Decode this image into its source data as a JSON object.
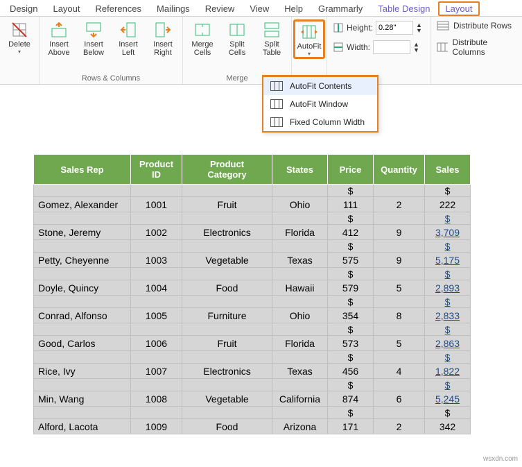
{
  "tabs": {
    "design": "Design",
    "layout1": "Layout",
    "references": "References",
    "mailings": "Mailings",
    "review": "Review",
    "view": "View",
    "help": "Help",
    "grammarly": "Grammarly",
    "table_design": "Table Design",
    "layout2": "Layout"
  },
  "ribbon": {
    "delete": "Delete",
    "insert_above": "Insert Above",
    "insert_below": "Insert Below",
    "insert_left": "Insert Left",
    "insert_right": "Insert Right",
    "rows_cols": "Rows & Columns",
    "merge_cells": "Merge Cells",
    "split_cells": "Split Cells",
    "split_table": "Split Table",
    "merge": "Merge",
    "autofit": "AutoFit",
    "height_lbl": "Height:",
    "height_val": "0.28\"",
    "width_lbl": "Width:",
    "width_val": "",
    "dist_rows": "Distribute Rows",
    "dist_cols": "Distribute Columns"
  },
  "dropdown": {
    "contents": "AutoFit Contents",
    "window": "AutoFit Window",
    "fixed": "Fixed Column Width"
  },
  "table": {
    "headers": {
      "sales_rep": "Sales Rep",
      "product_id": "Product ID",
      "category": "Product Category",
      "states": "States",
      "price": "Price",
      "quantity": "Quantity",
      "sales": "Sales"
    },
    "currency": "$",
    "rows": [
      {
        "rep": "Gomez, Alexander",
        "pid": "1001",
        "cat": "Fruit",
        "state": "Ohio",
        "price": "111",
        "qty": "2",
        "sales": "222",
        "link": false
      },
      {
        "rep": "Stone, Jeremy",
        "pid": "1002",
        "cat": "Electronics",
        "state": "Florida",
        "price": "412",
        "qty": "9",
        "sales": "3,709",
        "link": true
      },
      {
        "rep": "Petty, Cheyenne",
        "pid": "1003",
        "cat": "Vegetable",
        "state": "Texas",
        "price": "575",
        "qty": "9",
        "sales": "5,175",
        "link": true
      },
      {
        "rep": "Doyle, Quincy",
        "pid": "1004",
        "cat": "Food",
        "state": "Hawaii",
        "price": "579",
        "qty": "5",
        "sales": "2,893",
        "link": true
      },
      {
        "rep": "Conrad, Alfonso",
        "pid": "1005",
        "cat": "Furniture",
        "state": "Ohio",
        "price": "354",
        "qty": "8",
        "sales": "2,833",
        "link": true
      },
      {
        "rep": "Good, Carlos",
        "pid": "1006",
        "cat": "Fruit",
        "state": "Florida",
        "price": "573",
        "qty": "5",
        "sales": "2,863",
        "link": true
      },
      {
        "rep": "Rice, Ivy",
        "pid": "1007",
        "cat": "Electronics",
        "state": "Texas",
        "price": "456",
        "qty": "4",
        "sales": "1,822",
        "link": true
      },
      {
        "rep": "Min, Wang",
        "pid": "1008",
        "cat": "Vegetable",
        "state": "California",
        "price": "874",
        "qty": "6",
        "sales": "5,245",
        "link": true
      },
      {
        "rep": "Alford, Lacota",
        "pid": "1009",
        "cat": "Food",
        "state": "Arizona",
        "price": "171",
        "qty": "2",
        "sales": "342",
        "link": false
      }
    ]
  },
  "watermark": "wsxdn.com"
}
